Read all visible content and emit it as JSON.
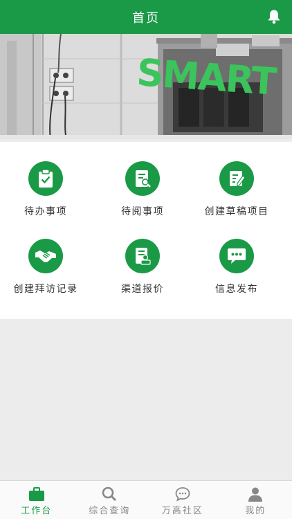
{
  "header": {
    "title": "首页",
    "bell_icon": "bell-icon"
  },
  "banner": {
    "logo_text": "SMART"
  },
  "menu": [
    {
      "label": "待办事项",
      "icon": "clipboard-check-icon"
    },
    {
      "label": "待阅事项",
      "icon": "document-search-icon"
    },
    {
      "label": "创建草稿项目",
      "icon": "edit-document-icon"
    },
    {
      "label": "创建拜访记录",
      "icon": "handshake-icon"
    },
    {
      "label": "渠道报价",
      "icon": "document-stamp-icon"
    },
    {
      "label": "信息发布",
      "icon": "chat-bubble-icon"
    }
  ],
  "tabs": [
    {
      "label": "工作台",
      "icon": "briefcase-icon",
      "active": true
    },
    {
      "label": "综合查询",
      "icon": "search-icon",
      "active": false
    },
    {
      "label": "万高社区",
      "icon": "chat-icon",
      "active": false
    },
    {
      "label": "我的",
      "icon": "user-icon",
      "active": false
    }
  ],
  "colors": {
    "brand": "#1a9a46",
    "background": "#ececec",
    "tab_inactive": "#888888"
  }
}
